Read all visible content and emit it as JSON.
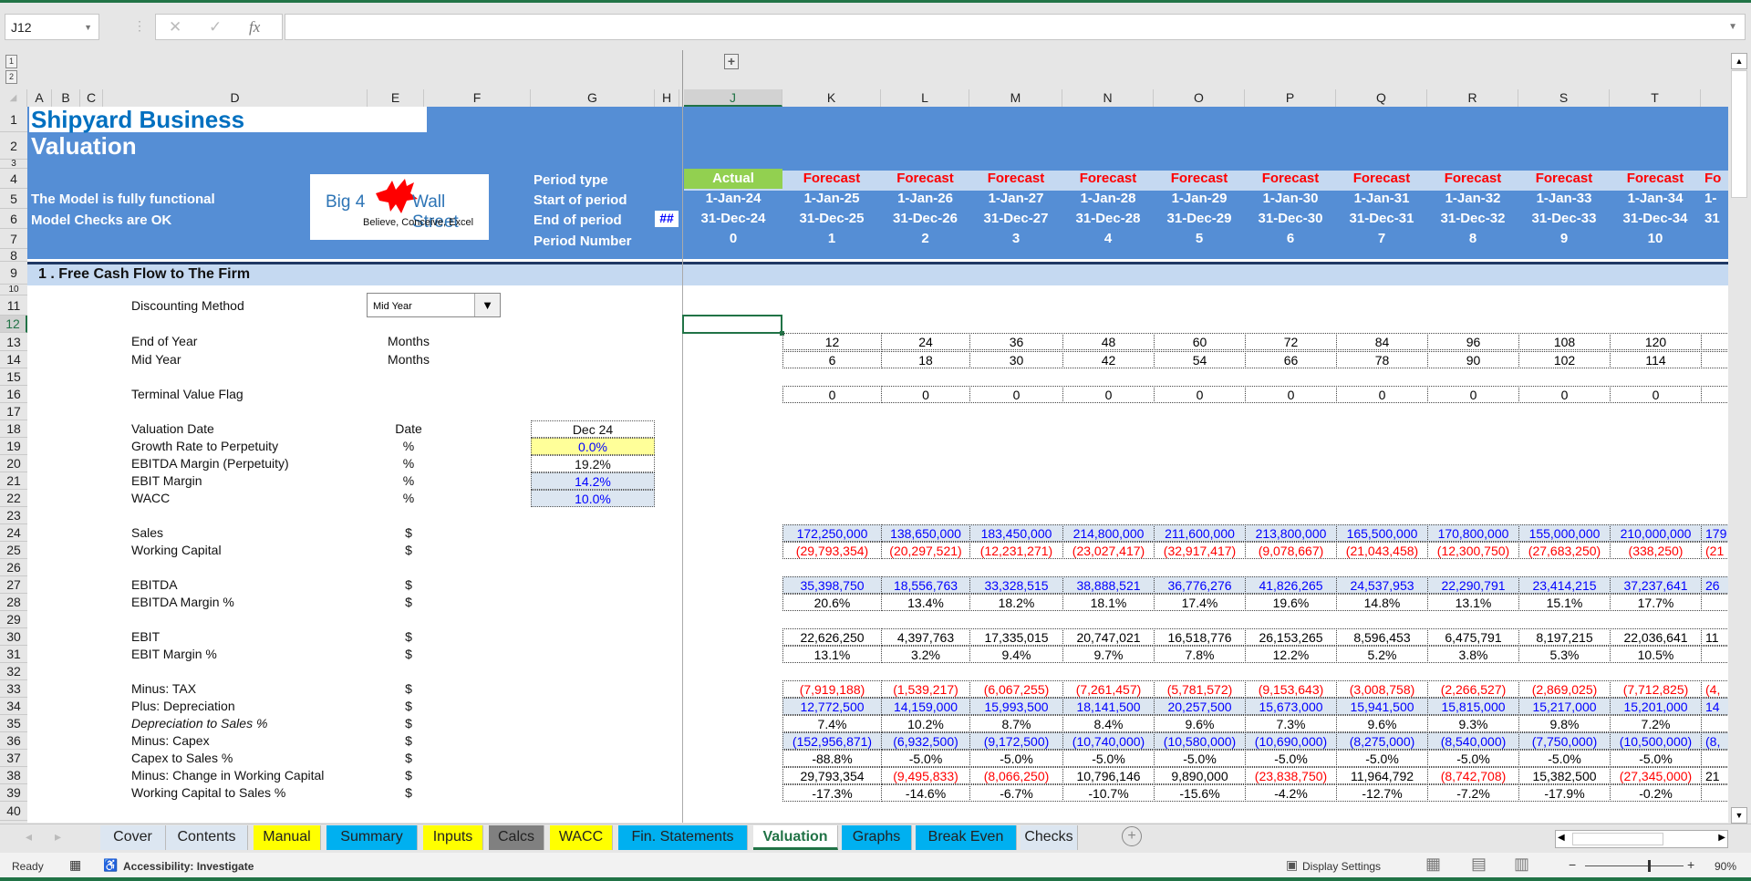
{
  "formula_bar": {
    "name_box": "J12",
    "formula": ""
  },
  "columns": [
    "A",
    "B",
    "C",
    "D",
    "E",
    "F",
    "G",
    "H",
    "J",
    "K",
    "L",
    "M",
    "N",
    "O",
    "P",
    "Q",
    "R",
    "S",
    "T"
  ],
  "header": {
    "title_line1": "Shipyard Business",
    "title_line2": "Valuation",
    "status1": "The Model is fully functional",
    "status2": "Model Checks are OK",
    "logo": {
      "left": "Big 4",
      "right": "Wall Street",
      "tagline": "Believe, Conceive, Excel"
    },
    "row_labels": [
      "Period type",
      "Start of period",
      "End of period",
      "Period Number"
    ],
    "hash_cell": "##",
    "periods": [
      {
        "type": "Actual",
        "start": "1-Jan-24",
        "end": "31-Dec-24",
        "num": "0"
      },
      {
        "type": "Forecast",
        "start": "1-Jan-25",
        "end": "31-Dec-25",
        "num": "1"
      },
      {
        "type": "Forecast",
        "start": "1-Jan-26",
        "end": "31-Dec-26",
        "num": "2"
      },
      {
        "type": "Forecast",
        "start": "1-Jan-27",
        "end": "31-Dec-27",
        "num": "3"
      },
      {
        "type": "Forecast",
        "start": "1-Jan-28",
        "end": "31-Dec-28",
        "num": "4"
      },
      {
        "type": "Forecast",
        "start": "1-Jan-29",
        "end": "31-Dec-29",
        "num": "5"
      },
      {
        "type": "Forecast",
        "start": "1-Jan-30",
        "end": "31-Dec-30",
        "num": "6"
      },
      {
        "type": "Forecast",
        "start": "1-Jan-31",
        "end": "31-Dec-31",
        "num": "7"
      },
      {
        "type": "Forecast",
        "start": "1-Jan-32",
        "end": "31-Dec-32",
        "num": "8"
      },
      {
        "type": "Forecast",
        "start": "1-Jan-33",
        "end": "31-Dec-33",
        "num": "9"
      },
      {
        "type": "Forecast",
        "start": "1-Jan-34",
        "end": "31-Dec-34",
        "num": "10"
      },
      {
        "type": "Fo",
        "start": "1-",
        "end": "31",
        "num": ""
      }
    ],
    "colors": {
      "band": "#558ed5",
      "actual": "#92d050",
      "forecast_text": "#ff0000",
      "ptype_band": "#c5d9f1"
    }
  },
  "section": {
    "title": "1 . Free Cash Flow to The Firm",
    "discounting_label": "Discounting Method",
    "discounting_value": "Mid Year",
    "timing": [
      {
        "label": "End of Year",
        "unit": "Months",
        "values": [
          "12",
          "24",
          "36",
          "48",
          "60",
          "72",
          "84",
          "96",
          "108",
          "120",
          ""
        ]
      },
      {
        "label": "Mid Year",
        "unit": "Months",
        "values": [
          "6",
          "18",
          "30",
          "42",
          "54",
          "66",
          "78",
          "90",
          "102",
          "114",
          ""
        ]
      }
    ],
    "terminal_flag": {
      "label": "Terminal Value Flag",
      "values": [
        "0",
        "0",
        "0",
        "0",
        "0",
        "0",
        "0",
        "0",
        "0",
        "0",
        ""
      ]
    },
    "assumptions": [
      {
        "label": "Valuation Date",
        "unit": "Date",
        "value": "Dec 24",
        "style": "plain"
      },
      {
        "label": "Growth Rate to Perpetuity",
        "unit": "%",
        "value": "0.0%",
        "style": "yellow"
      },
      {
        "label": "EBITDA Margin (Perpetuity)",
        "unit": "%",
        "value": "19.2%",
        "style": "plain"
      },
      {
        "label": "EBIT Margin",
        "unit": "%",
        "value": "14.2%",
        "style": "blue"
      },
      {
        "label": "WACC",
        "unit": "%",
        "value": "10.0%",
        "style": "blue"
      }
    ],
    "rows": [
      {
        "row": 24,
        "label": "Sales",
        "unit": "$",
        "style": "blue",
        "values": [
          "172,250,000",
          "138,650,000",
          "183,450,000",
          "214,800,000",
          "211,600,000",
          "213,800,000",
          "165,500,000",
          "170,800,000",
          "155,000,000",
          "210,000,000",
          "179"
        ]
      },
      {
        "row": 25,
        "label": "Working Capital",
        "unit": "$",
        "style": "plain",
        "values": [
          "(29,793,354)",
          "(20,297,521)",
          "(12,231,271)",
          "(23,027,417)",
          "(32,917,417)",
          "(9,078,667)",
          "(21,043,458)",
          "(12,300,750)",
          "(27,683,250)",
          "(338,250)",
          "(21"
        ]
      },
      {
        "row": 27,
        "label": "EBITDA",
        "unit": "$",
        "style": "blue",
        "values": [
          "35,398,750",
          "18,556,763",
          "33,328,515",
          "38,888,521",
          "36,776,276",
          "41,826,265",
          "24,537,953",
          "22,290,791",
          "23,414,215",
          "37,237,641",
          "26"
        ]
      },
      {
        "row": 28,
        "label": "EBITDA Margin %",
        "unit": "$",
        "style": "plain",
        "values": [
          "20.6%",
          "13.4%",
          "18.2%",
          "18.1%",
          "17.4%",
          "19.6%",
          "14.8%",
          "13.1%",
          "15.1%",
          "17.7%",
          ""
        ]
      },
      {
        "row": 30,
        "label": "EBIT",
        "unit": "$",
        "style": "plain",
        "values": [
          "22,626,250",
          "4,397,763",
          "17,335,015",
          "20,747,021",
          "16,518,776",
          "26,153,265",
          "8,596,453",
          "6,475,791",
          "8,197,215",
          "22,036,641",
          "11"
        ]
      },
      {
        "row": 31,
        "label": "EBIT Margin %",
        "unit": "$",
        "style": "plain",
        "values": [
          "13.1%",
          "3.2%",
          "9.4%",
          "9.7%",
          "7.8%",
          "12.2%",
          "5.2%",
          "3.8%",
          "5.3%",
          "10.5%",
          ""
        ]
      },
      {
        "row": 33,
        "label": "Minus: TAX",
        "unit": "$",
        "style": "plain",
        "values": [
          "(7,919,188)",
          "(1,539,217)",
          "(6,067,255)",
          "(7,261,457)",
          "(5,781,572)",
          "(9,153,643)",
          "(3,008,758)",
          "(2,266,527)",
          "(2,869,025)",
          "(7,712,825)",
          "(4,"
        ]
      },
      {
        "row": 34,
        "label": "Plus: Depreciation",
        "unit": "$",
        "style": "blue",
        "values": [
          "12,772,500",
          "14,159,000",
          "15,993,500",
          "18,141,500",
          "20,257,500",
          "15,673,000",
          "15,941,500",
          "15,815,000",
          "15,217,000",
          "15,201,000",
          "14"
        ]
      },
      {
        "row": 35,
        "label": "Depreciation to Sales %",
        "unit": "$",
        "style": "plain",
        "italic": true,
        "values": [
          "7.4%",
          "10.2%",
          "8.7%",
          "8.4%",
          "9.6%",
          "7.3%",
          "9.6%",
          "9.3%",
          "9.8%",
          "7.2%",
          ""
        ]
      },
      {
        "row": 36,
        "label": "Minus: Capex",
        "unit": "$",
        "style": "blue",
        "values": [
          "(152,956,871)",
          "(6,932,500)",
          "(9,172,500)",
          "(10,740,000)",
          "(10,580,000)",
          "(10,690,000)",
          "(8,275,000)",
          "(8,540,000)",
          "(7,750,000)",
          "(10,500,000)",
          "(8,"
        ]
      },
      {
        "row": 37,
        "label": "Capex to Sales %",
        "unit": "$",
        "style": "plain",
        "values": [
          "-88.8%",
          "-5.0%",
          "-5.0%",
          "-5.0%",
          "-5.0%",
          "-5.0%",
          "-5.0%",
          "-5.0%",
          "-5.0%",
          "-5.0%",
          ""
        ]
      },
      {
        "row": 38,
        "label": "Minus: Change in Working Capital",
        "unit": "$",
        "style": "plain",
        "values": [
          "29,793,354",
          "(9,495,833)",
          "(8,066,250)",
          "10,796,146",
          "9,890,000",
          "(23,838,750)",
          "11,964,792",
          "(8,742,708)",
          "15,382,500",
          "(27,345,000)",
          "21"
        ]
      },
      {
        "row": 39,
        "label": "Working Capital to Sales %",
        "unit": "$",
        "style": "plain",
        "values": [
          "-17.3%",
          "-14.6%",
          "-6.7%",
          "-10.7%",
          "-15.6%",
          "-4.2%",
          "-12.7%",
          "-7.2%",
          "-17.9%",
          "-0.2%",
          ""
        ]
      }
    ]
  },
  "sheet_tabs": [
    {
      "label": "Cover",
      "color": "#dce6f1"
    },
    {
      "label": "Contents",
      "color": "#dce6f1"
    },
    {
      "label": "Manual",
      "color": "#ffff00"
    },
    {
      "label": "Summary",
      "color": "#00b0f0"
    },
    {
      "label": "Inputs",
      "color": "#ffff00"
    },
    {
      "label": "Calcs",
      "color": "#808080"
    },
    {
      "label": "WACC",
      "color": "#ffff00"
    },
    {
      "label": "Fin. Statements",
      "color": "#00b0f0"
    },
    {
      "label": "Valuation",
      "color": "#ffffff",
      "active": true
    },
    {
      "label": "Graphs",
      "color": "#00b0f0"
    },
    {
      "label": "Break Even",
      "color": "#00b0f0"
    },
    {
      "label": "Checks",
      "color": "#dce6f1"
    }
  ],
  "status_bar": {
    "ready": "Ready",
    "accessibility": "Accessibility: Investigate",
    "display_settings": "Display Settings",
    "zoom": "90%",
    "zoom_level": 0.9
  }
}
